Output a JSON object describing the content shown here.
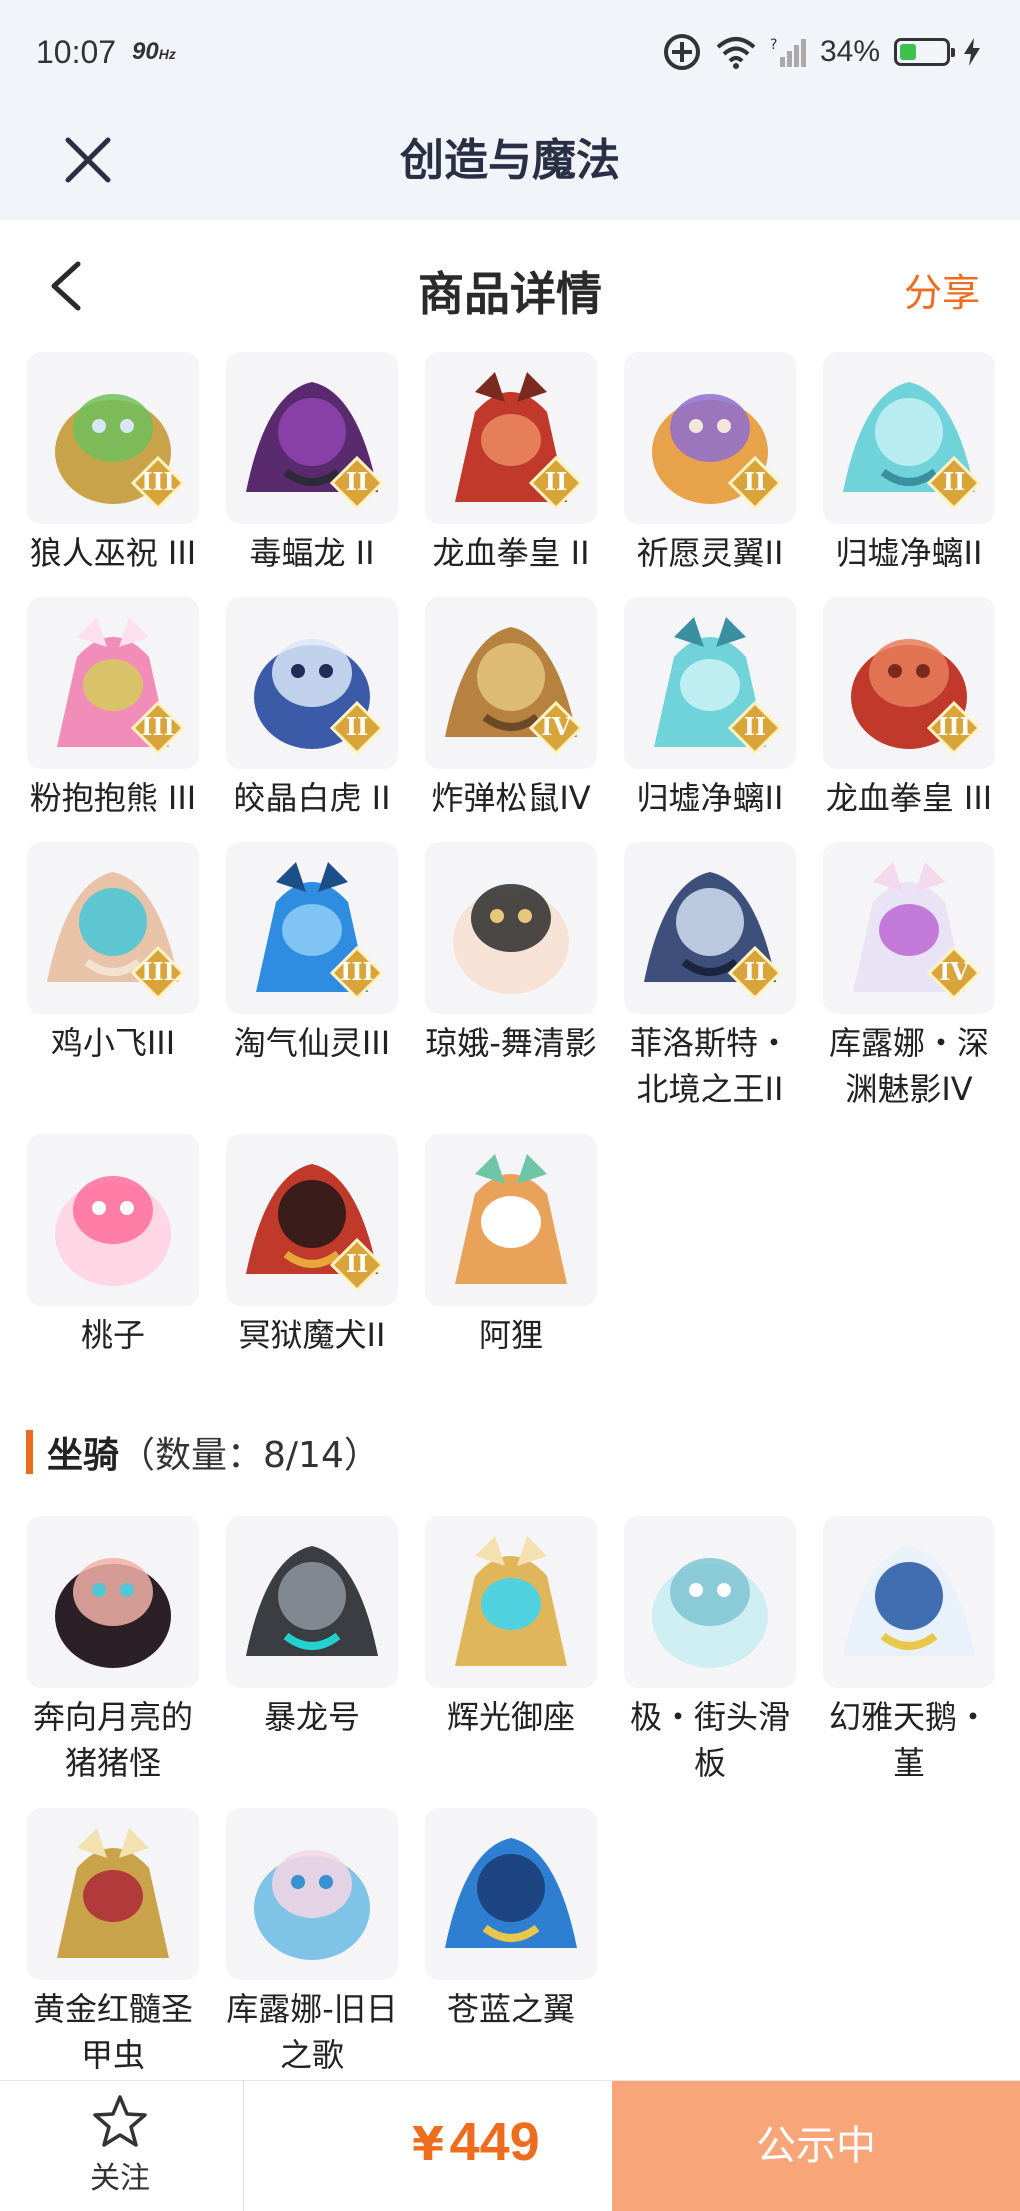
{
  "status": {
    "time": "10:07",
    "refresh": "90",
    "refresh_unit": "Hz",
    "battery": "34%"
  },
  "app": {
    "title": "创造与魔法"
  },
  "header": {
    "title": "商品详情",
    "share": "分享"
  },
  "pets": [
    {
      "name": "狼人巫祝 III",
      "tier": "III"
    },
    {
      "name": "毒蝠龙 II",
      "tier": "II"
    },
    {
      "name": "龙血拳皇 II",
      "tier": "II"
    },
    {
      "name": "祈愿灵翼II",
      "tier": "II"
    },
    {
      "name": "归墟净螭II",
      "tier": "II"
    },
    {
      "name": "粉抱抱熊 III",
      "tier": "III"
    },
    {
      "name": "皎晶白虎 II",
      "tier": "II"
    },
    {
      "name": "炸弹松鼠IV",
      "tier": "IV"
    },
    {
      "name": "归墟净螭II",
      "tier": "II"
    },
    {
      "name": "龙血拳皇 III",
      "tier": "III"
    },
    {
      "name": "鸡小飞III",
      "tier": "III"
    },
    {
      "name": "淘气仙灵III",
      "tier": "III"
    },
    {
      "name": "琼娥-舞清影",
      "tier": ""
    },
    {
      "name": "菲洛斯特・北境之王II",
      "tier": "II"
    },
    {
      "name": "库露娜・深渊魅影IV",
      "tier": "IV"
    },
    {
      "name": "桃子",
      "tier": ""
    },
    {
      "name": "冥狱魔犬II",
      "tier": "II"
    },
    {
      "name": "阿狸",
      "tier": ""
    }
  ],
  "mounts_section": {
    "label": "坐骑",
    "count": "（数量：8/14）"
  },
  "mounts": [
    {
      "name": "奔向月亮的猪猪怪"
    },
    {
      "name": "暴龙号"
    },
    {
      "name": "辉光御座"
    },
    {
      "name": "极・街头滑板"
    },
    {
      "name": "幻雅天鹅・堇"
    },
    {
      "name": "黄金红髓圣甲虫"
    },
    {
      "name": "库露娜-旧日之歌"
    },
    {
      "name": "苍蓝之翼"
    }
  ],
  "bottom": {
    "follow": "关注",
    "currency": "¥",
    "price": "449",
    "action": "公示中"
  },
  "colors": {
    "accent": "#ee6c1e",
    "cta": "#f8a57a",
    "bar_bg": "#f1f4f8"
  }
}
